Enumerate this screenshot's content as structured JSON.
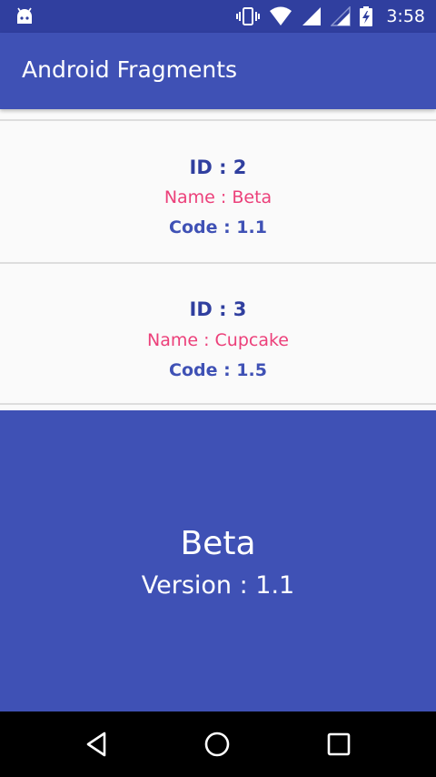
{
  "status_bar": {
    "time": "3:58",
    "icons": [
      "android-debug-icon",
      "vibrate-icon",
      "wifi-icon",
      "signal-icon",
      "signal-weak-icon",
      "battery-charging-icon"
    ]
  },
  "app_bar": {
    "title": "Android Fragments"
  },
  "list": {
    "items": [
      {
        "id_text": "ID : 2",
        "name_text": "Name : Beta",
        "code_text": "Code : 1.1"
      },
      {
        "id_text": "ID : 3",
        "name_text": "Name : Cupcake",
        "code_text": "Code : 1.5"
      }
    ]
  },
  "detail": {
    "name": "Beta",
    "version_text": "Version : 1.1"
  },
  "nav_bar": {
    "buttons": [
      "back-icon",
      "home-icon",
      "recents-icon"
    ]
  },
  "colors": {
    "status_bar": "#303f9f",
    "primary": "#3f51b5",
    "accent_pink": "#ec407a",
    "id_text": "#303f9f",
    "list_background": "#fafafa",
    "divider": "#dddddd",
    "nav_bar": "#000000"
  }
}
